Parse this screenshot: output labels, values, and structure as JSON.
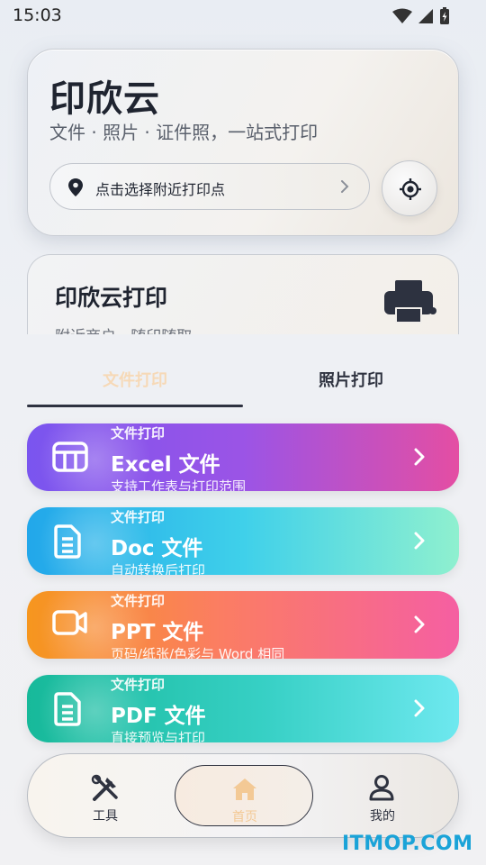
{
  "status_bar": {
    "time": "15:03"
  },
  "hero": {
    "title": "印欣云",
    "subtitle": "文件 · 照片 · 证件照，一站式打印",
    "location_label": "点击选择附近打印点"
  },
  "print_card": {
    "title": "印欣云打印",
    "subtitle": "附近商户 · 随印随取"
  },
  "tabs": [
    {
      "label": "文件打印",
      "active": true
    },
    {
      "label": "照片打印",
      "active": false
    }
  ],
  "cards": [
    {
      "kicker": "文件打印",
      "title": "Excel 文件",
      "desc": "支持工作表与打印范围",
      "icon": "table-icon"
    },
    {
      "kicker": "文件打印",
      "title": "Doc 文件",
      "desc": "自动转换后打印",
      "icon": "document-icon"
    },
    {
      "kicker": "文件打印",
      "title": "PPT 文件",
      "desc": "页码/纸张/色彩与 Word 相同",
      "icon": "presentation-icon"
    },
    {
      "kicker": "文件打印",
      "title": "PDF 文件",
      "desc": "直接预览与打印",
      "icon": "pdf-icon"
    }
  ],
  "bottom_nav": [
    {
      "label": "工具",
      "icon": "tools-icon"
    },
    {
      "label": "首页",
      "icon": "home-icon",
      "active": true
    },
    {
      "label": "我的",
      "icon": "user-icon"
    }
  ],
  "watermark": "ITMOP.COM",
  "colors": {
    "tab_active": "#f6d9b7",
    "home_active": "#f3c995",
    "accent_dark": "#2e3240"
  }
}
